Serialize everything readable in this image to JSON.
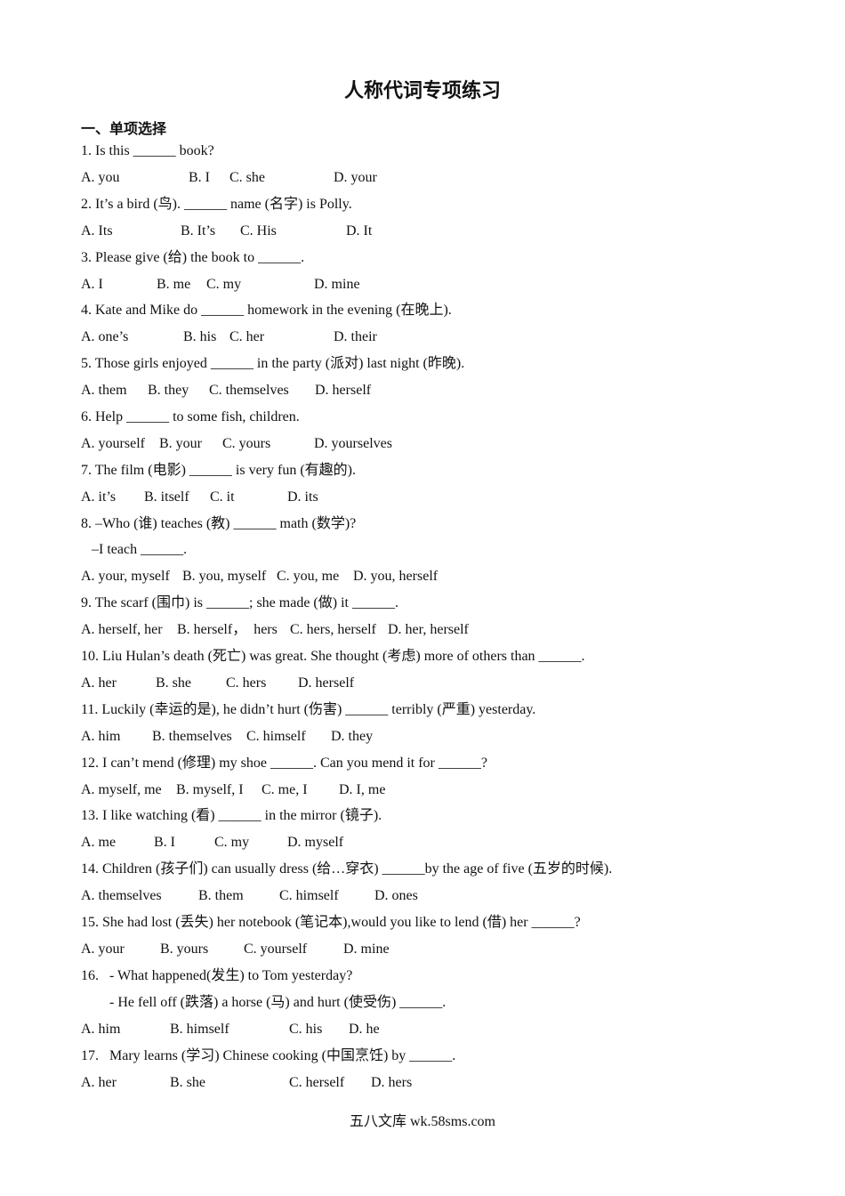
{
  "title": "人称代词专项练习",
  "section": "一、单项选择",
  "questions": [
    {
      "lines": [
        "1. Is this ______ book?"
      ],
      "options": [
        "A. you",
        "B. I",
        "C. she",
        "D. your"
      ]
    },
    {
      "lines": [
        "2. It’s a bird (鸟). ______ name (名字) is Polly."
      ],
      "options": [
        "A. Its",
        "B. It’s",
        "C. His",
        "D. It"
      ]
    },
    {
      "lines": [
        "3. Please give (给) the book to ______."
      ],
      "options": [
        "A. I",
        "B. me",
        "C. my",
        "D. mine"
      ]
    },
    {
      "lines": [
        "4. Kate and Mike do ______ homework in the evening (在晚上)."
      ],
      "options": [
        "A. one’s",
        "B. his",
        "C. her",
        "D. their"
      ]
    },
    {
      "lines": [
        "5. Those girls enjoyed ______ in the party (派对) last night (昨晚)."
      ],
      "options": [
        "A. them",
        "B. they",
        "C. themselves",
        "D. herself"
      ]
    },
    {
      "lines": [
        "6. Help ______ to some fish, children."
      ],
      "options": [
        "A. yourself",
        "B. your",
        "C. yours",
        "D. yourselves"
      ]
    },
    {
      "lines": [
        "7. The film (电影) ______ is very fun (有趣的)."
      ],
      "options": [
        "A. it’s",
        "B. itself",
        "C. it",
        "D. its"
      ]
    },
    {
      "lines": [
        "8. –Who (谁) teaches (教) ______ math (数学)?",
        "   –I teach ______."
      ],
      "options": [
        "A. your, myself",
        "B. you, myself",
        "C. you, me",
        "D. you, herself"
      ]
    },
    {
      "lines": [
        "9. The scarf (围巾) is ______; she made (做) it ______."
      ],
      "options": [
        "A. herself, her",
        "B. herself，  hers",
        "C. hers, herself",
        "D. her, herself"
      ]
    },
    {
      "lines": [
        "10. Liu Hulan’s death (死亡) was great. She thought (考虑) more of others than ______."
      ],
      "options": [
        "A. her",
        "B. she",
        "C. hers",
        "D. herself"
      ]
    },
    {
      "lines": [
        "11. Luckily (幸运的是), he didn’t hurt (伤害) ______ terribly (严重) yesterday."
      ],
      "options": [
        "A. him",
        "B. themselves",
        "C. himself",
        "D. they"
      ]
    },
    {
      "lines": [
        "12. I can’t mend (修理) my shoe ______. Can you mend it for ______?"
      ],
      "options": [
        "A. myself, me",
        "B. myself, I",
        "C. me, I",
        "D. I, me"
      ]
    },
    {
      "lines": [
        "13. I like watching (看) ______ in the mirror (镜子)."
      ],
      "options": [
        "A. me",
        "B. I",
        "C. my",
        "D. myself"
      ]
    },
    {
      "lines": [
        "14. Children (孩子们) can usually dress (给…穿衣) ______by the age of five (五岁的时候)."
      ],
      "options": [
        "A. themselves",
        "B. them",
        "C. himself",
        "D. ones"
      ]
    },
    {
      "lines": [
        "15. She had lost (丢失) her notebook (笔记本),would you like to lend (借) her ______?"
      ],
      "options": [
        "A. your",
        "B. yours",
        "C. yourself",
        "D. mine"
      ]
    },
    {
      "lines": [
        "16.   - What happened(发生) to Tom yesterday?",
        "        - He fell off (跌落) a horse (马) and hurt (使受伤) ______."
      ],
      "options": [
        "A. him",
        "B. himself",
        "C. his",
        "D. he"
      ]
    },
    {
      "lines": [
        "17.   Mary learns (学习) Chinese cooking (中国烹饪) by ______."
      ],
      "options": [
        "A. her",
        "B. she",
        "C. herself",
        "D. hers"
      ]
    }
  ],
  "footer": "五八文库 wk.58sms.com"
}
